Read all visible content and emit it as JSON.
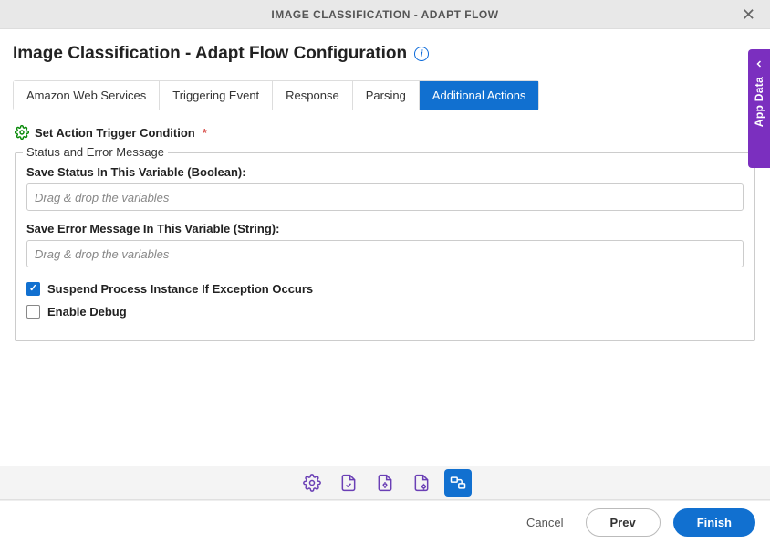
{
  "header": {
    "title": "IMAGE CLASSIFICATION - ADAPT FLOW"
  },
  "page": {
    "title": "Image Classification - Adapt Flow Configuration"
  },
  "tabs": [
    {
      "label": "Amazon Web Services"
    },
    {
      "label": "Triggering Event"
    },
    {
      "label": "Response"
    },
    {
      "label": "Parsing"
    },
    {
      "label": "Additional Actions"
    }
  ],
  "trigger": {
    "label": "Set Action Trigger Condition"
  },
  "fieldset": {
    "legend": "Status and Error Message",
    "status_label": "Save Status In This Variable (Boolean):",
    "status_placeholder": "Drag & drop the variables",
    "error_label": "Save Error Message In This Variable (String):",
    "error_placeholder": "Drag & drop the variables",
    "suspend_label": "Suspend Process Instance If Exception Occurs",
    "debug_label": "Enable Debug"
  },
  "sidebar": {
    "label": "App Data"
  },
  "footer": {
    "cancel": "Cancel",
    "prev": "Prev",
    "finish": "Finish"
  }
}
